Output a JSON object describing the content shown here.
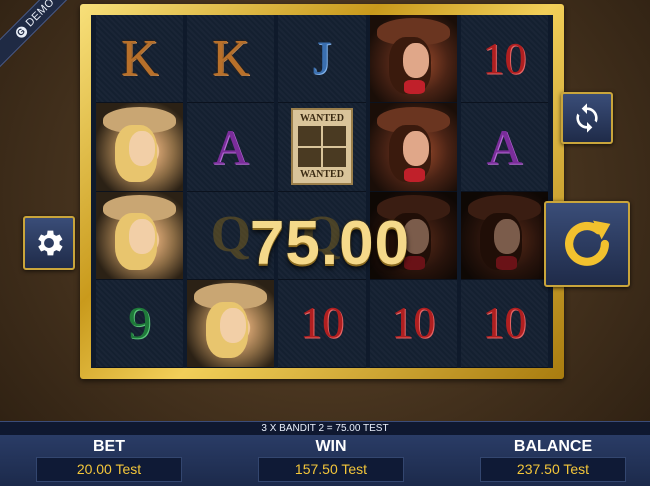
{
  "demo_badge": {
    "icon": "g-logo-icon",
    "label": "DEMO"
  },
  "reels": [
    [
      "K",
      "blonde",
      "blonde",
      "9"
    ],
    [
      "K",
      "A",
      "Q",
      "blonde"
    ],
    [
      "J",
      "wanted",
      "Q",
      "10"
    ],
    [
      "brunette",
      "brunette",
      "brunette-dim",
      "10"
    ],
    [
      "10",
      "A",
      "brunette-dim",
      "10"
    ]
  ],
  "wanted_poster": {
    "top_text": "WANTED",
    "bottom_text": "WANTED"
  },
  "win_display": {
    "amount": "75.00"
  },
  "buttons": {
    "settings": {
      "icon": "gear-icon"
    },
    "autoplay": {
      "icon": "refresh-arrows-icon"
    },
    "spin": {
      "icon": "spin-arrow-icon"
    }
  },
  "info_line": "3 X BANDIT 2 = 75.00 TEST",
  "stats": {
    "bet": {
      "label": "BET",
      "value": "20.00 Test"
    },
    "win": {
      "label": "WIN",
      "value": "157.50 Test"
    },
    "balance": {
      "label": "BALANCE",
      "value": "237.50 Test"
    }
  },
  "colors": {
    "frame_gold": "#d4a82a",
    "panel_navy": "#1c2a4b",
    "value_yellow": "#f3c63a"
  }
}
